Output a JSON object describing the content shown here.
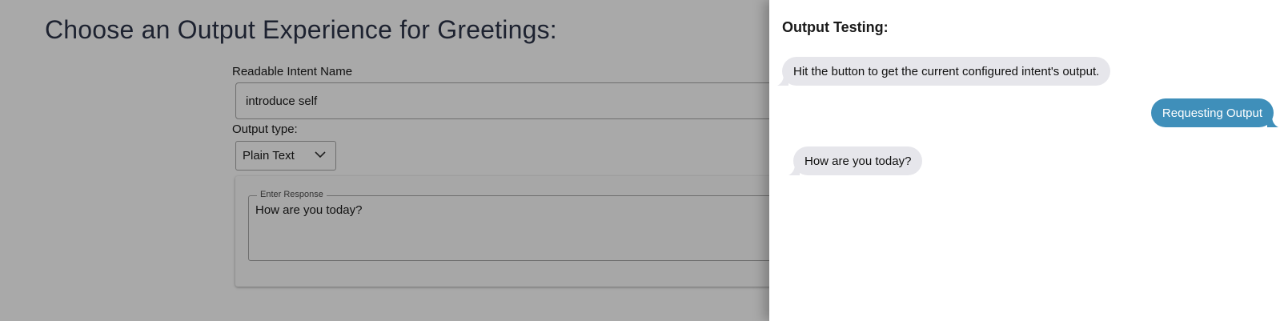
{
  "main": {
    "title": "Choose an Output Experience for Greetings:",
    "intent_label": "Readable Intent Name",
    "intent_value": "introduce self",
    "output_type_label": "Output type:",
    "output_type_value": "Plain Text",
    "response_legend": "Enter Response",
    "response_value": "How are you today?"
  },
  "drawer": {
    "title": "Output Testing:",
    "messages": [
      {
        "from": "system",
        "text": "Hit the button to get the current configured intent's output."
      },
      {
        "from": "user",
        "text": "Requesting Output"
      },
      {
        "from": "system",
        "text": "How are you today?"
      }
    ]
  },
  "colors": {
    "overlay_bg": "#a9a9a9",
    "user_bubble": "#3f8fba",
    "system_bubble": "#e6e6eb"
  }
}
